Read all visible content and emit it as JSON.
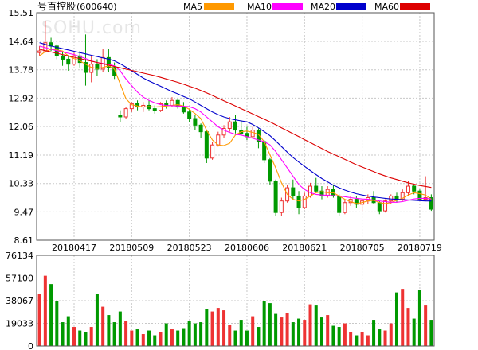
{
  "title": {
    "name": "号百控股",
    "code": "(600640)"
  },
  "watermark": "SOHU.com",
  "legend": [
    {
      "label": "MA5",
      "color": "#ff9900"
    },
    {
      "label": "MA10",
      "color": "#ff00ff"
    },
    {
      "label": "MA20",
      "color": "#0000cc"
    },
    {
      "label": "MA60",
      "color": "#dd0000"
    }
  ],
  "colors": {
    "up": "#ee3333",
    "down": "#009900",
    "grid": "#c8c8c8",
    "frame": "#555555"
  },
  "chart_data": [
    {
      "type": "candlestick",
      "title": "号百控股(600640)",
      "ylim": [
        8.61,
        15.51
      ],
      "y_ticks": [
        "15.51",
        "14.64",
        "13.78",
        "12.92",
        "12.06",
        "11.19",
        "10.33",
        "9.47",
        "8.61"
      ],
      "x_tick_labels": [
        "20180417",
        "20180509",
        "20180523",
        "20180606",
        "20180621",
        "20180705",
        "20180719"
      ],
      "x_tick_index": [
        6,
        16,
        26,
        36,
        46,
        56,
        66
      ],
      "ohlc": [
        [
          14.3,
          14.5,
          14.2,
          14.35
        ],
        [
          14.35,
          15.25,
          14.3,
          14.6
        ],
        [
          14.6,
          14.75,
          14.35,
          14.5
        ],
        [
          14.5,
          14.55,
          14.1,
          14.2
        ],
        [
          14.2,
          14.35,
          13.9,
          14.1
        ],
        [
          14.1,
          14.2,
          13.75,
          13.95
        ],
        [
          13.95,
          14.3,
          13.9,
          14.2
        ],
        [
          14.2,
          14.35,
          13.85,
          14.0
        ],
        [
          14.0,
          14.85,
          13.3,
          13.7
        ],
        [
          13.7,
          14.2,
          13.4,
          13.95
        ],
        [
          13.95,
          14.1,
          13.6,
          13.8
        ],
        [
          13.8,
          14.4,
          13.7,
          14.15
        ],
        [
          14.15,
          14.4,
          13.7,
          13.85
        ],
        [
          13.85,
          14.0,
          13.5,
          13.6
        ],
        [
          12.4,
          12.55,
          12.2,
          12.35
        ],
        [
          12.35,
          12.65,
          12.3,
          12.6
        ],
        [
          12.6,
          12.8,
          12.5,
          12.75
        ],
        [
          12.75,
          12.85,
          12.55,
          12.65
        ],
        [
          12.65,
          12.8,
          12.5,
          12.7
        ],
        [
          12.7,
          12.85,
          12.55,
          12.6
        ],
        [
          12.6,
          12.7,
          12.45,
          12.55
        ],
        [
          12.55,
          12.8,
          12.5,
          12.75
        ],
        [
          12.75,
          12.85,
          12.6,
          12.7
        ],
        [
          12.7,
          12.95,
          12.65,
          12.85
        ],
        [
          12.85,
          12.9,
          12.6,
          12.65
        ],
        [
          12.65,
          12.8,
          12.45,
          12.5
        ],
        [
          12.5,
          12.6,
          12.2,
          12.3
        ],
        [
          12.3,
          12.4,
          11.95,
          12.1
        ],
        [
          12.1,
          12.15,
          11.7,
          11.9
        ],
        [
          11.9,
          11.95,
          10.95,
          11.1
        ],
        [
          11.1,
          11.6,
          11.05,
          11.5
        ],
        [
          11.5,
          11.9,
          11.45,
          11.8
        ],
        [
          11.8,
          12.1,
          11.7,
          12.0
        ],
        [
          12.0,
          12.35,
          11.9,
          12.2
        ],
        [
          12.2,
          12.4,
          11.85,
          11.95
        ],
        [
          11.95,
          12.25,
          11.8,
          11.85
        ],
        [
          11.85,
          12.05,
          11.65,
          11.75
        ],
        [
          11.75,
          12.05,
          11.7,
          11.95
        ],
        [
          11.95,
          12.0,
          11.4,
          11.6
        ],
        [
          11.6,
          11.65,
          10.95,
          11.05
        ],
        [
          11.05,
          11.1,
          10.3,
          10.4
        ],
        [
          10.4,
          10.45,
          9.35,
          9.45
        ],
        [
          9.45,
          9.9,
          9.35,
          9.8
        ],
        [
          9.8,
          10.3,
          9.75,
          10.2
        ],
        [
          10.2,
          10.45,
          9.85,
          9.95
        ],
        [
          9.95,
          10.1,
          9.4,
          9.6
        ],
        [
          9.6,
          10.05,
          9.55,
          9.95
        ],
        [
          9.95,
          10.35,
          9.9,
          10.25
        ],
        [
          10.25,
          10.5,
          10.05,
          10.1
        ],
        [
          10.1,
          10.25,
          9.85,
          9.95
        ],
        [
          9.95,
          10.25,
          9.9,
          10.15
        ],
        [
          10.15,
          10.3,
          9.9,
          9.95
        ],
        [
          9.95,
          10.0,
          9.35,
          9.45
        ],
        [
          9.45,
          9.85,
          9.4,
          9.75
        ],
        [
          9.75,
          9.95,
          9.65,
          9.85
        ],
        [
          9.85,
          9.95,
          9.6,
          9.7
        ],
        [
          9.7,
          9.85,
          9.5,
          9.8
        ],
        [
          9.8,
          10.0,
          9.7,
          9.9
        ],
        [
          9.9,
          10.1,
          9.7,
          9.75
        ],
        [
          9.75,
          9.8,
          9.4,
          9.5
        ],
        [
          9.5,
          9.85,
          9.45,
          9.8
        ],
        [
          9.8,
          10.0,
          9.7,
          9.95
        ],
        [
          9.95,
          10.05,
          9.75,
          9.85
        ],
        [
          9.85,
          10.15,
          9.8,
          10.05
        ],
        [
          10.05,
          10.4,
          9.95,
          10.25
        ],
        [
          10.25,
          10.3,
          10.0,
          10.1
        ],
        [
          10.1,
          10.15,
          9.8,
          9.85
        ],
        [
          9.85,
          10.55,
          9.8,
          9.9
        ],
        [
          9.9,
          10.0,
          9.5,
          9.55
        ]
      ],
      "ma": {
        "MA5": [
          14.2,
          14.33,
          14.4,
          14.38,
          14.35,
          14.2,
          14.12,
          14.05,
          13.95,
          13.85,
          13.82,
          13.85,
          13.9,
          13.8,
          13.35,
          12.9,
          12.72,
          12.68,
          12.65,
          12.66,
          12.65,
          12.66,
          12.68,
          12.7,
          12.72,
          12.68,
          12.58,
          12.45,
          12.3,
          11.95,
          11.65,
          11.5,
          11.48,
          11.55,
          11.8,
          11.9,
          11.92,
          11.88,
          11.82,
          11.6,
          11.2,
          10.8,
          10.35,
          10.0,
          9.85,
          9.8,
          9.85,
          9.95,
          10.05,
          10.08,
          10.05,
          10.05,
          9.95,
          9.85,
          9.78,
          9.72,
          9.75,
          9.8,
          9.82,
          9.75,
          9.72,
          9.75,
          9.82,
          9.88,
          9.98,
          10.05,
          10.02,
          9.98,
          9.85
        ],
        "MA10": [
          14.5,
          14.45,
          14.4,
          14.36,
          14.32,
          14.28,
          14.24,
          14.18,
          14.12,
          14.05,
          14.0,
          13.97,
          13.94,
          13.9,
          13.75,
          13.5,
          13.3,
          13.1,
          12.95,
          12.85,
          12.78,
          12.72,
          12.7,
          12.69,
          12.68,
          12.67,
          12.66,
          12.6,
          12.5,
          12.35,
          12.2,
          12.05,
          11.95,
          11.88,
          11.82,
          11.8,
          11.75,
          11.7,
          11.65,
          11.6,
          11.5,
          11.3,
          11.05,
          10.8,
          10.55,
          10.3,
          10.15,
          10.05,
          10.0,
          9.98,
          9.97,
          9.96,
          9.95,
          9.93,
          9.9,
          9.88,
          9.86,
          9.85,
          9.83,
          9.8,
          9.78,
          9.76,
          9.76,
          9.78,
          9.82,
          9.86,
          9.88,
          9.88,
          9.86
        ],
        "MA20": [
          14.6,
          14.55,
          14.5,
          14.46,
          14.42,
          14.38,
          14.34,
          14.3,
          14.26,
          14.22,
          14.18,
          14.14,
          14.1,
          14.05,
          13.96,
          13.86,
          13.75,
          13.64,
          13.53,
          13.44,
          13.36,
          13.28,
          13.2,
          13.12,
          13.05,
          12.97,
          12.9,
          12.8,
          12.7,
          12.6,
          12.5,
          12.42,
          12.35,
          12.3,
          12.26,
          12.23,
          12.2,
          12.12,
          12.02,
          11.9,
          11.78,
          11.62,
          11.45,
          11.28,
          11.12,
          10.98,
          10.85,
          10.72,
          10.6,
          10.48,
          10.38,
          10.28,
          10.2,
          10.13,
          10.07,
          10.02,
          9.98,
          9.95,
          9.92,
          9.9,
          9.88,
          9.86,
          9.85,
          9.84,
          9.83,
          9.82,
          9.81,
          9.8,
          9.8
        ],
        "MA60": [
          14.4,
          14.36,
          14.32,
          14.28,
          14.24,
          14.2,
          14.16,
          14.12,
          14.08,
          14.04,
          14.0,
          13.96,
          13.92,
          13.88,
          13.84,
          13.8,
          13.76,
          13.72,
          13.68,
          13.64,
          13.6,
          13.55,
          13.5,
          13.45,
          13.4,
          13.34,
          13.28,
          13.22,
          13.15,
          13.08,
          13.0,
          12.92,
          12.84,
          12.76,
          12.68,
          12.6,
          12.52,
          12.44,
          12.36,
          12.28,
          12.2,
          12.11,
          12.02,
          11.93,
          11.84,
          11.75,
          11.66,
          11.57,
          11.48,
          11.39,
          11.3,
          11.22,
          11.14,
          11.06,
          10.98,
          10.9,
          10.83,
          10.76,
          10.69,
          10.62,
          10.56,
          10.5,
          10.45,
          10.4,
          10.35,
          10.31,
          10.27,
          10.24,
          10.21
        ]
      }
    },
    {
      "type": "bar",
      "title": "",
      "ylim": [
        0,
        76134
      ],
      "y_ticks": [
        "76134",
        "57100",
        "38067",
        "19033",
        "0"
      ],
      "values": [
        44000,
        59000,
        52000,
        38000,
        20000,
        25000,
        16000,
        13000,
        12000,
        16000,
        44000,
        33000,
        26000,
        20000,
        29000,
        21000,
        13000,
        14000,
        10000,
        13000,
        9000,
        12000,
        19000,
        14000,
        13000,
        15000,
        21000,
        19000,
        20000,
        31000,
        29000,
        32000,
        30000,
        18000,
        13000,
        22000,
        13000,
        25000,
        16000,
        38000,
        36000,
        27000,
        24000,
        28000,
        20000,
        23000,
        22000,
        35000,
        34000,
        24000,
        26000,
        17000,
        16000,
        19000,
        12000,
        9000,
        12000,
        9000,
        22000,
        14000,
        13000,
        19000,
        45000,
        48000,
        32000,
        23000,
        47000,
        34000,
        22000
      ]
    }
  ]
}
